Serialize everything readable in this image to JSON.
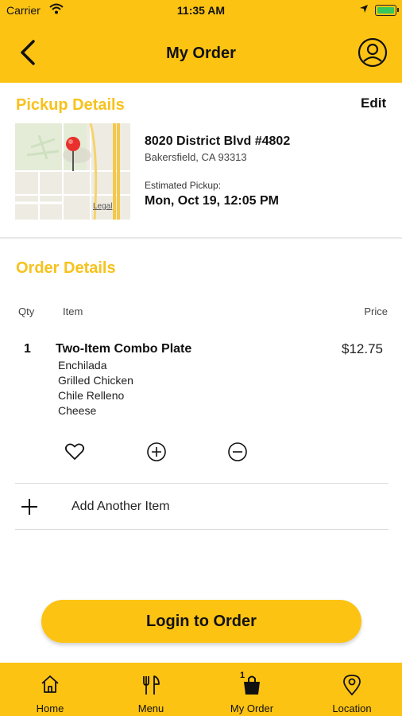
{
  "status_bar": {
    "carrier": "Carrier",
    "time": "11:35 AM"
  },
  "header": {
    "title": "My Order",
    "icons": [
      "chevron-left-icon",
      "user-circle-icon"
    ]
  },
  "pickup": {
    "heading": "Pickup Details",
    "edit_label": "Edit",
    "map_legal": "Legal",
    "address_line1": "8020 District Blvd #4802",
    "address_line2": "Bakersfield, CA 93313",
    "estimated_label": "Estimated Pickup:",
    "estimated_value": "Mon, Oct 19, 12:05 PM"
  },
  "order": {
    "heading": "Order Details",
    "columns": {
      "qty": "Qty",
      "item": "Item",
      "price": "Price"
    },
    "items": [
      {
        "qty": "1",
        "name": "Two-Item Combo Plate",
        "price": "$12.75",
        "modifiers": [
          "Enchilada",
          "Grilled Chicken",
          "Chile Relleno",
          "Cheese"
        ]
      }
    ],
    "add_item_label": "Add Another Item"
  },
  "cta": {
    "label": "Login to Order"
  },
  "tabs": [
    {
      "label": "Home",
      "icon": "home-icon"
    },
    {
      "label": "Menu",
      "icon": "fork-knife-icon"
    },
    {
      "label": "My Order",
      "icon": "bag-icon",
      "badge": "1",
      "active": true
    },
    {
      "label": "Location",
      "icon": "location-pin-icon"
    }
  ],
  "colors": {
    "brand": "#FDC313",
    "heading": "#F7C21C"
  }
}
